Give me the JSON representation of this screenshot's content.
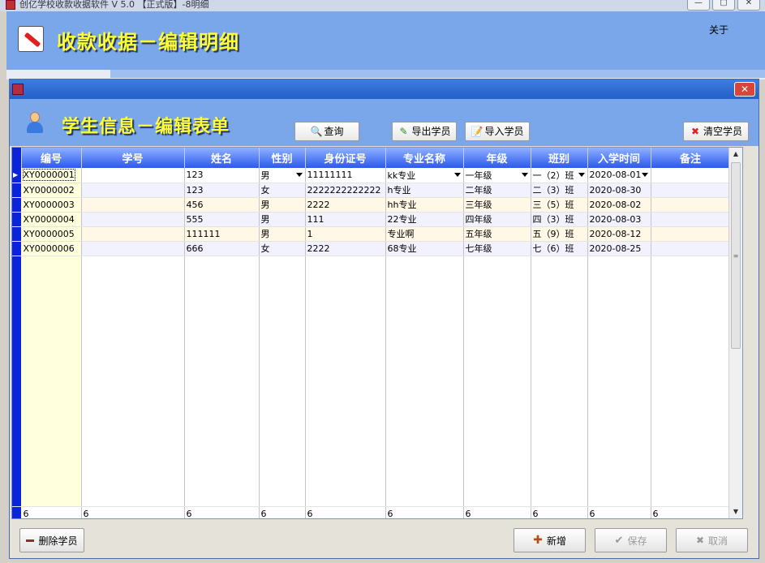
{
  "app": {
    "title": "创亿学校收款收据软件 V 5.0 【正式版】-8明细",
    "heading": "收款收据－编辑明细",
    "about": "关于",
    "window_buttons": [
      "—",
      "▢",
      "✕"
    ]
  },
  "dialog": {
    "close_glyph": "✕",
    "heading": "学生信息－编辑表单",
    "toolbar": {
      "query": "查询",
      "export": "导出学员",
      "import": "导入学员",
      "clear": "清空学员"
    },
    "columns": [
      "编号",
      "学号",
      "姓名",
      "性别",
      "身份证号",
      "专业名称",
      "年级",
      "班别",
      "入学时间",
      "备注"
    ],
    "rows": [
      {
        "code": "XY0000001",
        "sid": "",
        "name": "123",
        "gender": "男",
        "idno": "11111111",
        "major": "kk专业",
        "grade": "一年级",
        "cls": "一（2）班",
        "date": "2020-08-01",
        "note": ""
      },
      {
        "code": "XY0000002",
        "sid": "",
        "name": "123",
        "gender": "女",
        "idno": "2222222222222",
        "major": "h专业",
        "grade": "二年级",
        "cls": "二（3）班",
        "date": "2020-08-30",
        "note": ""
      },
      {
        "code": "XY0000003",
        "sid": "",
        "name": "456",
        "gender": "男",
        "idno": "2222",
        "major": "hh专业",
        "grade": "三年级",
        "cls": "三（5）班",
        "date": "2020-08-02",
        "note": ""
      },
      {
        "code": "XY0000004",
        "sid": "",
        "name": "555",
        "gender": "男",
        "idno": "111",
        "major": "22专业",
        "grade": "四年级",
        "cls": "四（3）班",
        "date": "2020-08-03",
        "note": ""
      },
      {
        "code": "XY0000005",
        "sid": "",
        "name": "111111",
        "gender": "男",
        "idno": "1",
        "major": "专业啊",
        "grade": "五年级",
        "cls": "五（9）班",
        "date": "2020-08-12",
        "note": ""
      },
      {
        "code": "XY0000006",
        "sid": "",
        "name": "666",
        "gender": "女",
        "idno": "2222",
        "major": "68专业",
        "grade": "七年级",
        "cls": "七（6）班",
        "date": "2020-08-25",
        "note": ""
      }
    ],
    "footer_counts": [
      "6",
      "6",
      "6",
      "6",
      "6",
      "6",
      "6",
      "6",
      "6",
      "6"
    ],
    "buttons": {
      "delete": "删除学员",
      "add": "新增",
      "save": "保存",
      "cancel": "取消"
    }
  }
}
